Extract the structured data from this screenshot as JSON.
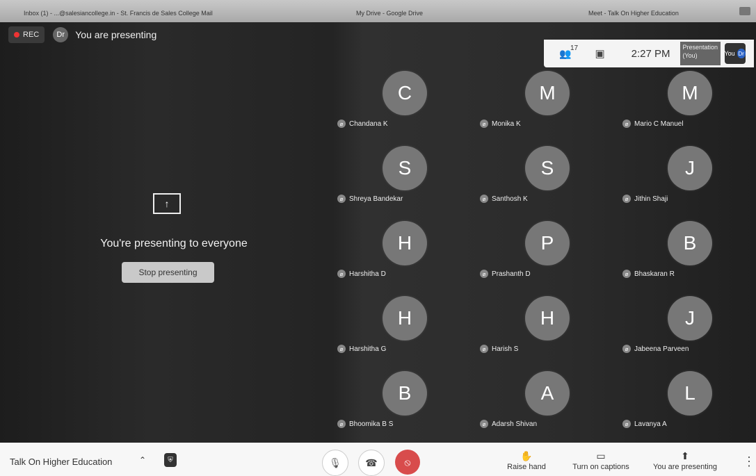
{
  "browser": {
    "tabs": [
      "Inbox (1) - ...@salesiancollege.in - St. Francis de Sales College Mail",
      "My Drive - Google Drive",
      "Meet - Talk On Higher Education"
    ]
  },
  "top_bar": {
    "rec_label": "REC",
    "presenter_initials": "Dr",
    "status_title": "You are presenting"
  },
  "top_right": {
    "participant_count": "17",
    "time": "2:27 PM",
    "presentation_tile_text": "Presentation (You)",
    "you_label": "You",
    "avatar_initials": "Dr"
  },
  "presenting_panel": {
    "message": "You're presenting to everyone",
    "button_label": "Stop presenting"
  },
  "participants": [
    {
      "initial": "C",
      "name": "Chandana K"
    },
    {
      "initial": "M",
      "name": "Monika K"
    },
    {
      "initial": "M",
      "name": "Mario C Manuel"
    },
    {
      "initial": "S",
      "name": "Shreya Bandekar"
    },
    {
      "initial": "S",
      "name": "Santhosh K"
    },
    {
      "initial": "J",
      "name": "Jithin Shaji"
    },
    {
      "initial": "H",
      "name": "Harshitha D"
    },
    {
      "initial": "P",
      "name": "Prashanth D"
    },
    {
      "initial": "B",
      "name": "Bhaskaran R"
    },
    {
      "initial": "H",
      "name": "Harshitha G"
    },
    {
      "initial": "H",
      "name": "Harish S"
    },
    {
      "initial": "J",
      "name": "Jabeena Parveen"
    },
    {
      "initial": "B",
      "name": "Bhoomika B S"
    },
    {
      "initial": "A",
      "name": "Adarsh Shivan"
    },
    {
      "initial": "L",
      "name": "Lavanya A"
    }
  ],
  "bottom_bar": {
    "meeting_name": "Talk On Higher Education",
    "raise_hand": "Raise hand",
    "captions": "Turn on captions",
    "presenting": "You are presenting"
  }
}
